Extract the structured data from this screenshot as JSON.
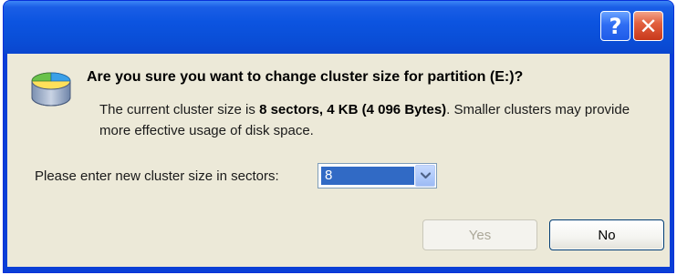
{
  "titlebar": {
    "help_label": "?",
    "close_label": "✕"
  },
  "dialog": {
    "question": "Are you sure you want to change cluster size for partition (E:)?",
    "message_prefix": "The current cluster size is ",
    "message_bold": "8 sectors, 4 KB (4 096 Bytes)",
    "message_suffix": ". Smaller clusters may provide more effective usage of disk space.",
    "prompt_label": "Please enter new cluster size in sectors:",
    "cluster_size_value": "8",
    "yes_label": "Yes",
    "no_label": "No",
    "yes_enabled": false
  },
  "colors": {
    "titlebar": "#0a4fd8",
    "client_bg": "#ece9d8",
    "selection": "#316ac5",
    "close_button": "#e26140"
  },
  "icons": {
    "dialog_icon": "disk-partition-icon",
    "help": "help-icon",
    "close": "close-icon",
    "dropdown": "chevron-down-icon"
  }
}
